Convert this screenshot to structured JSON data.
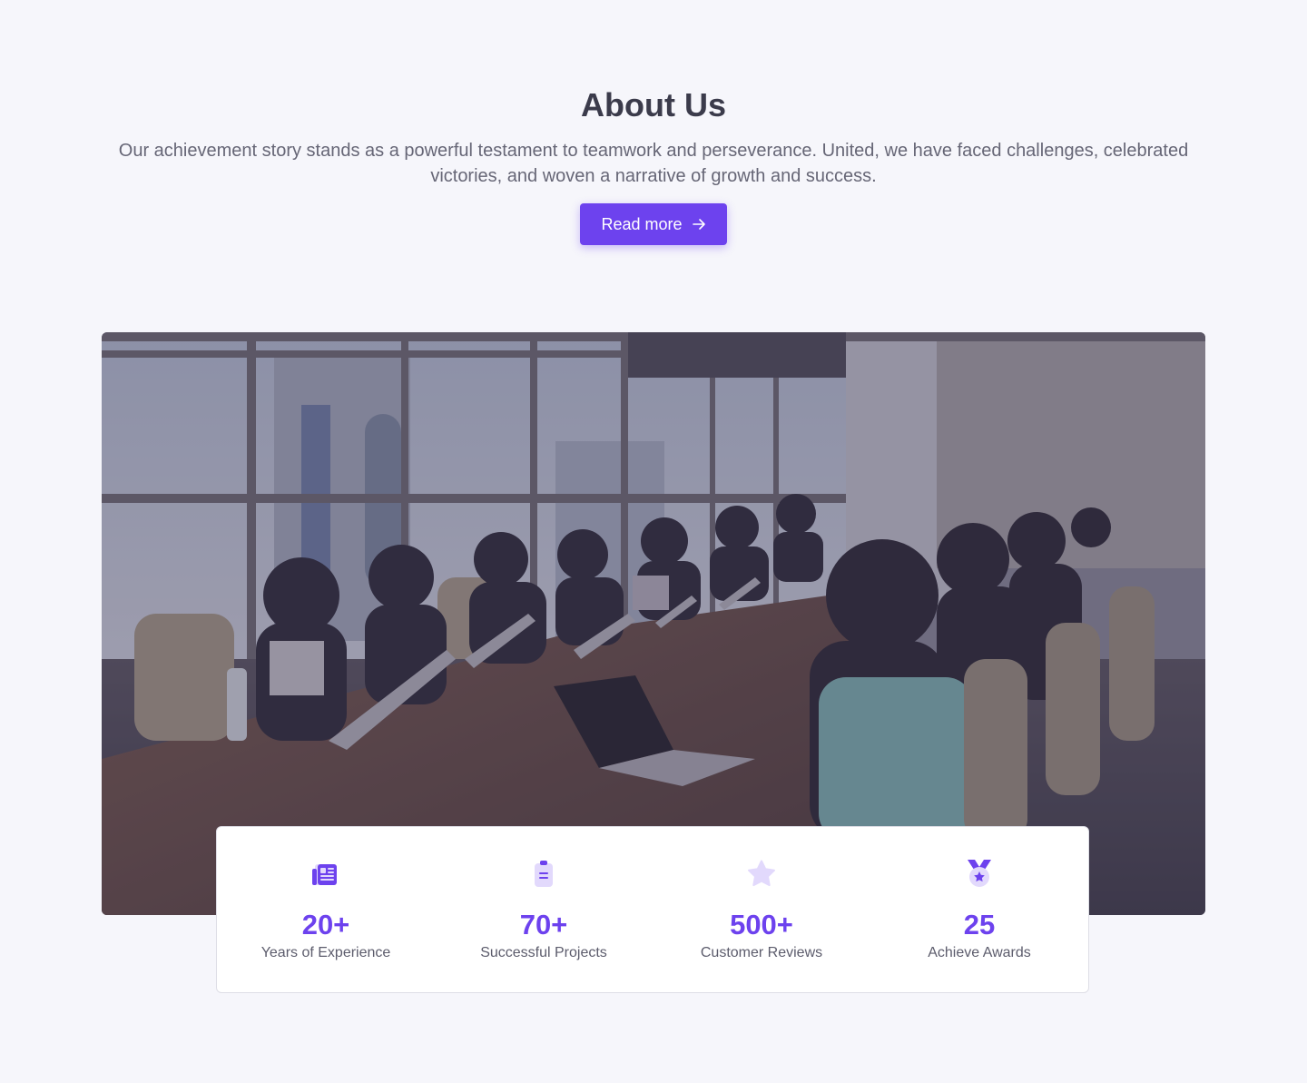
{
  "about": {
    "title": "About Us",
    "description": "Our achievement story stands as a powerful testament to teamwork and perseverance. United, we have faced challenges, celebrated victories, and woven a narrative of growth and success.",
    "button_label": "Read more",
    "button_icon": "arrow-right-icon"
  },
  "colors": {
    "accent": "#6d42ee",
    "accent_light": "#e2d9fc",
    "background": "#f6f6fb",
    "heading": "#3b3b4b",
    "body_text": "#666676"
  },
  "stats": [
    {
      "icon": "newspaper-icon",
      "value": "20+",
      "label": "Years of Experience"
    },
    {
      "icon": "clipboard-icon",
      "value": "70+",
      "label": "Successful Projects"
    },
    {
      "icon": "star-icon",
      "value": "500+",
      "label": "Customer Reviews"
    },
    {
      "icon": "medal-icon",
      "value": "25",
      "label": "Achieve Awards"
    }
  ]
}
